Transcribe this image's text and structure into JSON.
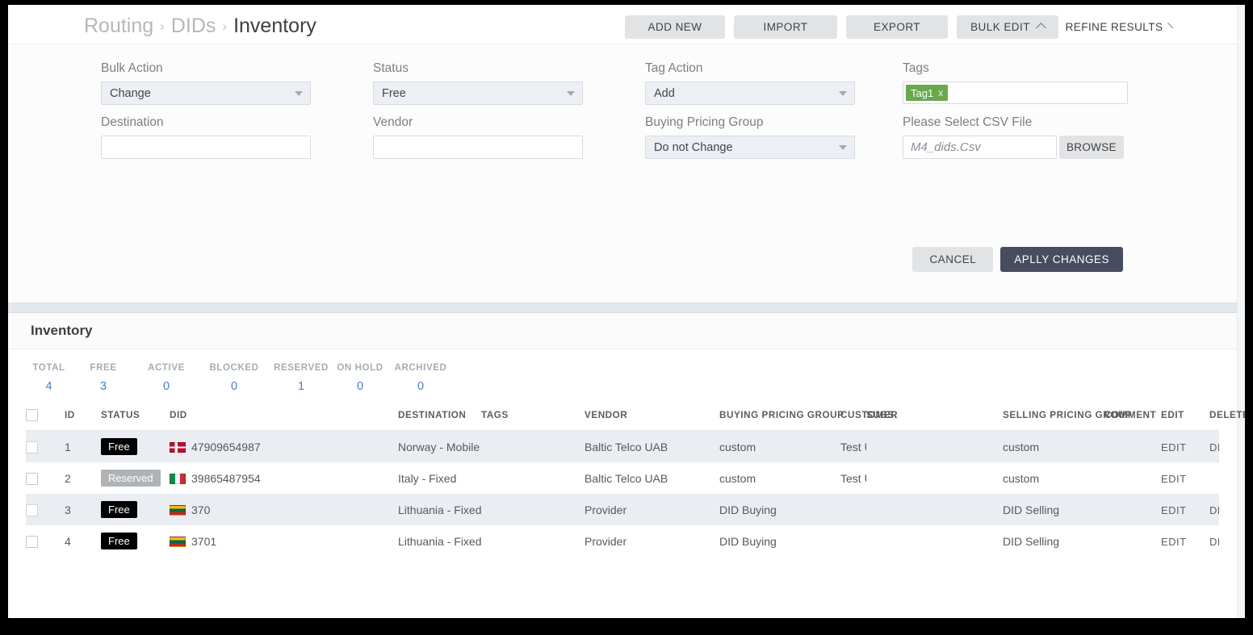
{
  "breadcrumb": {
    "items": [
      "Routing",
      "DIDs",
      "Inventory"
    ],
    "separator": "›"
  },
  "toolbar": {
    "add_new": "ADD NEW",
    "import": "IMPORT",
    "export": "EXPORT",
    "bulk_edit": "BULK EDIT",
    "refine_results": "REFINE RESULTS"
  },
  "bulk_panel": {
    "bulk_action": {
      "label": "Bulk Action",
      "value": "Change"
    },
    "status": {
      "label": "Status",
      "value": "Free"
    },
    "tag_action": {
      "label": "Tag Action",
      "value": "Add"
    },
    "tags": {
      "label": "Tags",
      "chips": [
        {
          "text": "Tag1",
          "remove": "x"
        }
      ],
      "value": ""
    },
    "destination": {
      "label": "Destination",
      "value": ""
    },
    "vendor": {
      "label": "Vendor",
      "value": ""
    },
    "buying_pricing_group": {
      "label": "Buying Pricing Group",
      "value": "Do not Change"
    },
    "csv": {
      "label": "Please Select CSV File",
      "placeholder": "M4_dids.Csv",
      "value": "",
      "browse": "BROWSE"
    },
    "cancel": "CANCEL",
    "apply": "APLLY CHANGES",
    "accent_color": "#474c60",
    "tag_color": "#6aa84f"
  },
  "inventory": {
    "title": "Inventory",
    "stats": [
      {
        "label": "TOTAL",
        "value": "4"
      },
      {
        "label": "FREE",
        "value": "3"
      },
      {
        "label": "ACTIVE",
        "value": "0"
      },
      {
        "label": "BLOCKED",
        "value": "0"
      },
      {
        "label": "RESERVED",
        "value": "1"
      },
      {
        "label": "ON HOLD",
        "value": "0"
      },
      {
        "label": "ARCHIVED",
        "value": "0"
      }
    ],
    "stat_link_color": "#3f7ecb",
    "columns": [
      "ID",
      "STATUS",
      "DID",
      "DESTINATION",
      "TAGS",
      "VENDOR",
      "BUYING PRICING GROUP",
      "CUSTOMER",
      "SUBS.",
      "SELLING PRICING GROUP",
      "COMMENT",
      "EDIT",
      "DELETE"
    ],
    "rows": [
      {
        "id": "1",
        "status": "Free",
        "status_kind": "free",
        "flag": "no",
        "did": "47909654987",
        "destination": "Norway - Mobile ...",
        "tags": "",
        "vendor": "Baltic Telco UAB",
        "buying_pricing_group": "custom",
        "customer": "Test User Account",
        "subs": "",
        "selling_pricing_group": "custom",
        "comment": "",
        "edit": "EDIT",
        "delete": "DELETE"
      },
      {
        "id": "2",
        "status": "Reserved",
        "status_kind": "reserved",
        "flag": "it",
        "did": "39865487954",
        "destination": "Italy - Fixed",
        "tags": "",
        "vendor": "Baltic Telco UAB",
        "buying_pricing_group": "custom",
        "customer": "Test User Account",
        "subs": "",
        "selling_pricing_group": "custom",
        "comment": "",
        "edit": "EDIT",
        "delete": ""
      },
      {
        "id": "3",
        "status": "Free",
        "status_kind": "free",
        "flag": "lt",
        "did": "370",
        "destination": "Lithuania - Fixed",
        "tags": "",
        "vendor": "Provider",
        "buying_pricing_group": "DID Buying",
        "customer": "",
        "subs": "",
        "selling_pricing_group": "DID Selling",
        "comment": "",
        "edit": "EDIT",
        "delete": "DELETE"
      },
      {
        "id": "4",
        "status": "Free",
        "status_kind": "free",
        "flag": "lt",
        "did": "3701",
        "destination": "Lithuania - Fixed",
        "tags": "",
        "vendor": "Provider",
        "buying_pricing_group": "DID Buying",
        "customer": "",
        "subs": "",
        "selling_pricing_group": "DID Selling",
        "comment": "",
        "edit": "EDIT",
        "delete": "DELETE"
      }
    ]
  }
}
